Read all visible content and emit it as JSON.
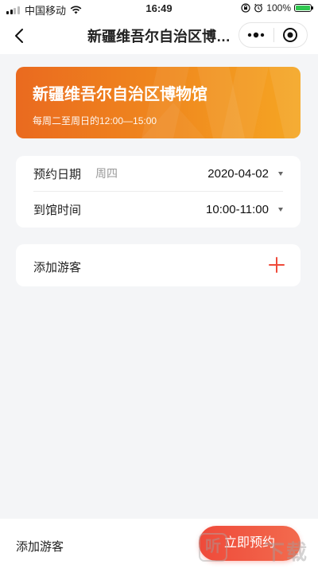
{
  "status_bar": {
    "carrier": "中国移动",
    "time": "16:49",
    "battery": "100%"
  },
  "nav": {
    "title": "新疆维吾尔自治区博…",
    "icons": [
      "back-icon",
      "more-icon",
      "close-icon"
    ]
  },
  "banner": {
    "title": "新疆维吾尔自治区博物馆",
    "hours": "每周二至周日的12:00—15:00",
    "colors": [
      "#ea6a1f",
      "#f5a623"
    ]
  },
  "booking": {
    "date_label": "预约日期",
    "weekday": "周四",
    "date": "2020-04-02",
    "time_label": "到馆时间",
    "time": "10:00-11:00"
  },
  "visitors": {
    "add_label": "添加游客",
    "accent": "#ef4a3a"
  },
  "bottom": {
    "add_label": "添加游客",
    "book_button": "立即预约"
  },
  "watermark": {
    "icon_text": "听",
    "text": "下载"
  }
}
